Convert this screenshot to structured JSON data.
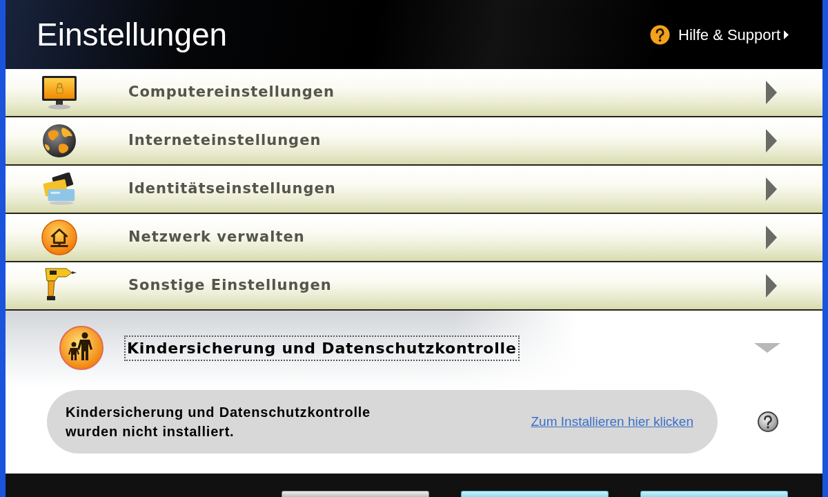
{
  "header": {
    "title": "Einstellungen",
    "help_link": "Hilfe & Support"
  },
  "sections": [
    {
      "label": "Computereinstellungen",
      "expanded": false,
      "focused": false
    },
    {
      "label": "Interneteinstellungen",
      "expanded": false,
      "focused": false
    },
    {
      "label": "Identitätseinstellungen",
      "expanded": false,
      "focused": false
    },
    {
      "label": "Netzwerk verwalten",
      "expanded": false,
      "focused": false
    },
    {
      "label": "Sonstige Einstellungen",
      "expanded": false,
      "focused": false
    },
    {
      "label": "Kindersicherung und Datenschutzkontrolle",
      "expanded": true,
      "focused": true,
      "message": "Kindersicherung und Datenschutzkontrolle wurden nicht installiert.",
      "link": "Zum Installieren hier klicken"
    }
  ],
  "footer_buttons": [
    {
      "kind": "secondary"
    },
    {
      "kind": "primary"
    },
    {
      "kind": "primary"
    }
  ]
}
